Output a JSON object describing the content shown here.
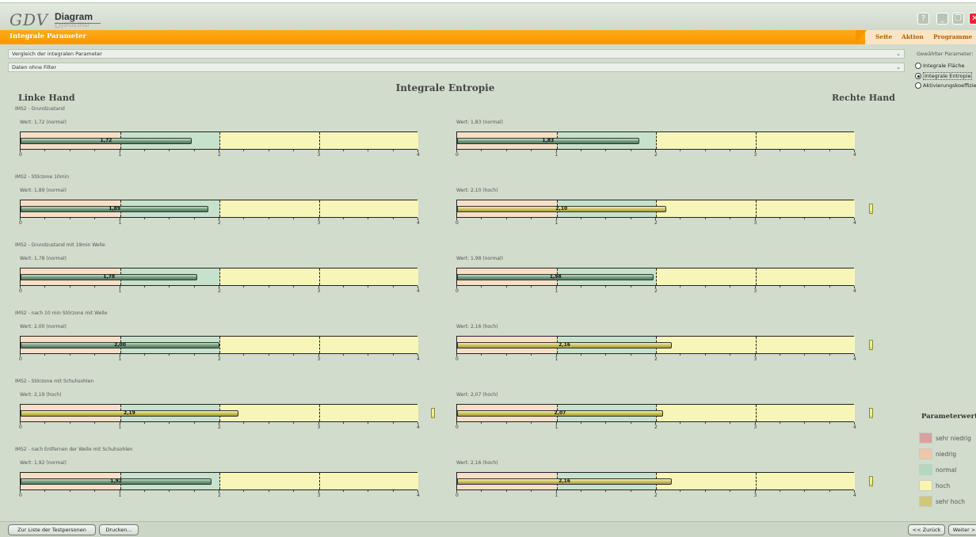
{
  "app": {
    "logo_text": "GDV",
    "logo_subtitle": "Diagram"
  },
  "window_controls": [
    "?",
    "_",
    "❐",
    "✕"
  ],
  "menubar": {
    "title": "Integrale Parameter",
    "items": [
      "Seite",
      "Aktion",
      "Programme"
    ]
  },
  "dropdowns": {
    "comparison": "Vergleich der integralen Parameter",
    "filter": "Daten ohne Filter"
  },
  "parameter_panel": {
    "label": "Gewählter Parameter:",
    "options": [
      {
        "label": "Integrale Fläche",
        "selected": false
      },
      {
        "label": "Integrale Entropie",
        "selected": true
      },
      {
        "label": "Aktivierungskoeffizient",
        "selected": false
      }
    ]
  },
  "chart": {
    "title": "Integrale Entropie",
    "left_heading": "Linke Hand",
    "right_heading": "Rechte Hand",
    "axis_ticks": [
      "0",
      "1",
      "2",
      "3",
      "4"
    ]
  },
  "chart_data": {
    "type": "bar",
    "xlim": [
      0,
      4
    ],
    "zones": [
      {
        "name": "sehr niedrig",
        "from": 0,
        "to": 0
      },
      {
        "name": "niedrig",
        "from": 0,
        "to": 1
      },
      {
        "name": "normal",
        "from": 1,
        "to": 2
      },
      {
        "name": "hoch",
        "from": 2,
        "to": 4
      }
    ],
    "rows": [
      {
        "title": "IMS2 - Grundzustand",
        "left": {
          "value": 1.72,
          "value_text": "1,72",
          "label": "Wert: 1,72 (normal)",
          "status": "normal"
        },
        "right": {
          "value": 1.83,
          "value_text": "1,83",
          "label": "Wert: 1,83 (normal)",
          "status": "normal"
        }
      },
      {
        "title": "IMS2 - Störzone 10min",
        "left": {
          "value": 1.89,
          "value_text": "1,89",
          "label": "Wert: 1,89 (normal)",
          "status": "normal"
        },
        "right": {
          "value": 2.1,
          "value_text": "2,10",
          "label": "Wert: 2,10 (hoch)",
          "status": "hoch"
        }
      },
      {
        "title": "IMS2 - Grundzustand mit 19min Welle",
        "left": {
          "value": 1.78,
          "value_text": "1,78",
          "label": "Wert: 1,78 (normal)",
          "status": "normal"
        },
        "right": {
          "value": 1.98,
          "value_text": "1,98",
          "label": "Wert: 1,98 (normal)",
          "status": "normal"
        }
      },
      {
        "title": "IMS2 - nach 10 min Störzone mit Welle",
        "left": {
          "value": 2.0,
          "value_text": "2,00",
          "label": "Wert: 2,00 (normal)",
          "status": "normal"
        },
        "right": {
          "value": 2.16,
          "value_text": "2,16",
          "label": "Wert: 2,16 (hoch)",
          "status": "hoch"
        }
      },
      {
        "title": "IMS2 - Störzone mit Schuhsohlen",
        "left": {
          "value": 2.19,
          "value_text": "2,19",
          "label": "Wert: 2,19 (hoch)",
          "status": "hoch"
        },
        "right": {
          "value": 2.07,
          "value_text": "2,07",
          "label": "Wert: 2,07 (hoch)",
          "status": "hoch"
        }
      },
      {
        "title": "IMS2 - nach Entfernen der Welle mit Schuhsohlen",
        "left": {
          "value": 1.92,
          "value_text": "1,92",
          "label": "Wert: 1,92 (normal)",
          "status": "normal"
        },
        "right": {
          "value": 2.16,
          "value_text": "2,16",
          "label": "Wert: 2,16 (hoch)",
          "status": "hoch"
        }
      }
    ]
  },
  "legend": {
    "title": "Parameterwert:",
    "items": [
      {
        "label": "sehr niedrig",
        "color": "#d9a0a0"
      },
      {
        "label": "niedrig",
        "color": "#efc7a8"
      },
      {
        "label": "normal",
        "color": "#b3d8bd"
      },
      {
        "label": "hoch",
        "color": "#f7f5b2"
      },
      {
        "label": "sehr hoch",
        "color": "#cfc87a"
      }
    ]
  },
  "colors": {
    "zone_niedrig": "#f6dfc6",
    "zone_normal": "#c7e2cc",
    "zone_hoch": "#f7f6b8",
    "accent": "#f79700"
  },
  "footer": {
    "back_to_list": "Zur Liste der Testpersonen",
    "print": "Drucken...",
    "prev": "<< Zurück",
    "next": "Weiter >"
  }
}
